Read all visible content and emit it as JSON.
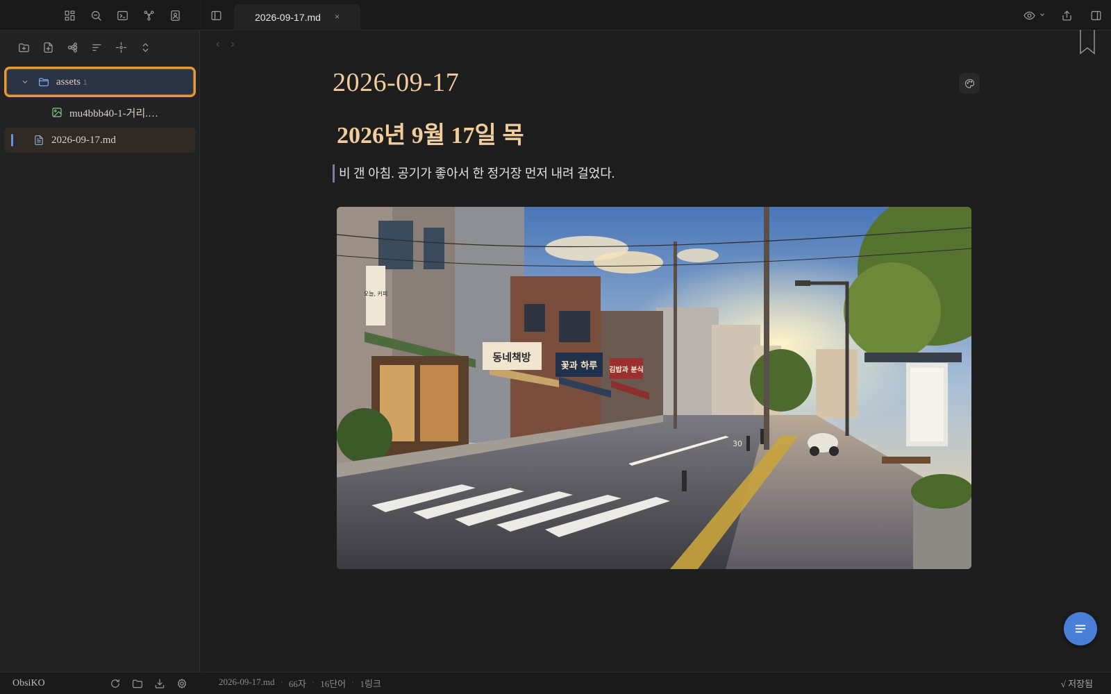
{
  "sidebar": {
    "ribbon_icons": [
      "layout-grid-icon",
      "search-zoom-icon",
      "terminal-icon",
      "graph-icon",
      "contact-icon"
    ],
    "toolbar_icons": [
      "new-folder-icon",
      "new-file-icon",
      "graph-tree-icon",
      "sort-icon",
      "locate-icon",
      "expand-collapse-icon"
    ],
    "tree": {
      "folder": {
        "label": "assets",
        "count": "1"
      },
      "image_file": {
        "label": "mu4bbb40-1-거리.…"
      },
      "active_file": {
        "label": "2026-09-17.md"
      }
    },
    "vault_name": "ObsiKO",
    "bottom_icons": [
      "refresh-icon",
      "folder-icon",
      "download-icon",
      "settings-icon"
    ]
  },
  "header": {
    "tab_label": "2026-09-17.md",
    "tab_close": "×"
  },
  "content": {
    "nav_back": "‹",
    "nav_forward": "›",
    "title": "2026-09-17",
    "heading": "2026년 9월 17일 목",
    "quote": "비 갠 아침. 공기가 좋아서 한 정거장 먼저 내려 걸었다.",
    "image": {
      "shop_signs": [
        "동네책방",
        "꽃과 하루",
        "김밥과 분식"
      ],
      "vertical_sign": "오늘, 커피",
      "road_number": "30"
    }
  },
  "status": {
    "filename": "2026-09-17.md",
    "chars": "66자",
    "words": "16단어",
    "links": "1링크",
    "saved": "√ 저장됨"
  },
  "colors": {
    "accent": "#4a7fd8",
    "heading": "#f0cc9e",
    "selection_border": "#e59a38"
  }
}
